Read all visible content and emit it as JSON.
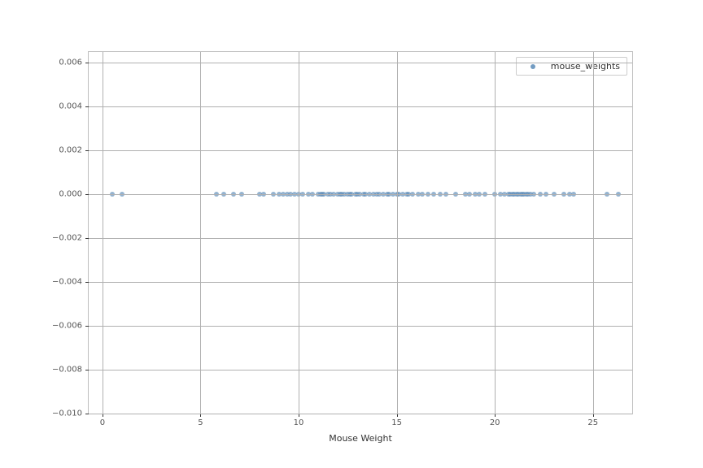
{
  "chart_data": {
    "type": "scatter",
    "title": "",
    "xlabel": "Mouse Weight",
    "ylabel": "",
    "xlim": [
      -0.7,
      27.0
    ],
    "ylim": [
      -0.01,
      0.0065
    ],
    "xticks": [
      0,
      5,
      10,
      15,
      20,
      25
    ],
    "yticks": [
      -0.01,
      -0.008,
      -0.006,
      -0.004,
      -0.002,
      0.0,
      0.002,
      0.004,
      0.006
    ],
    "ytick_labels": [
      "−0.010",
      "−0.008",
      "−0.006",
      "−0.004",
      "−0.002",
      "0.000",
      "0.002",
      "0.004",
      "0.006"
    ],
    "grid": true,
    "series": [
      {
        "name": "mouse_weights",
        "color": "#5a8bb7",
        "x": [
          0.5,
          1.0,
          5.8,
          6.2,
          6.7,
          7.1,
          8.0,
          8.2,
          8.7,
          9.0,
          9.2,
          9.4,
          9.6,
          9.8,
          10.0,
          10.2,
          10.5,
          10.7,
          11.0,
          11.1,
          11.2,
          11.3,
          11.5,
          11.6,
          11.8,
          12.0,
          12.1,
          12.2,
          12.3,
          12.5,
          12.6,
          12.7,
          12.9,
          13.0,
          13.1,
          13.3,
          13.4,
          13.6,
          13.8,
          14.0,
          14.1,
          14.3,
          14.5,
          14.6,
          14.8,
          15.0,
          15.1,
          15.3,
          15.5,
          15.6,
          15.8,
          16.1,
          16.3,
          16.6,
          16.9,
          17.2,
          17.5,
          18.0,
          18.5,
          18.7,
          19.0,
          19.2,
          19.5,
          20.0,
          20.3,
          20.5,
          20.7,
          20.8,
          20.9,
          21.0,
          21.1,
          21.2,
          21.3,
          21.4,
          21.5,
          21.6,
          21.7,
          21.8,
          22.0,
          22.3,
          22.6,
          23.0,
          23.5,
          23.8,
          24.0,
          25.7,
          26.3
        ],
        "y": [
          0,
          0,
          0,
          0,
          0,
          0,
          0,
          0,
          0,
          0,
          0,
          0,
          0,
          0,
          0,
          0,
          0,
          0,
          0,
          0,
          0,
          0,
          0,
          0,
          0,
          0,
          0,
          0,
          0,
          0,
          0,
          0,
          0,
          0,
          0,
          0,
          0,
          0,
          0,
          0,
          0,
          0,
          0,
          0,
          0,
          0,
          0,
          0,
          0,
          0,
          0,
          0,
          0,
          0,
          0,
          0,
          0,
          0,
          0,
          0,
          0,
          0,
          0,
          0,
          0,
          0,
          0,
          0,
          0,
          0,
          0,
          0,
          0,
          0,
          0,
          0,
          0,
          0,
          0,
          0,
          0,
          0,
          0,
          0,
          0,
          0,
          0
        ]
      }
    ],
    "legend": {
      "position": "upper right",
      "entries": [
        "mouse_weights"
      ]
    }
  }
}
